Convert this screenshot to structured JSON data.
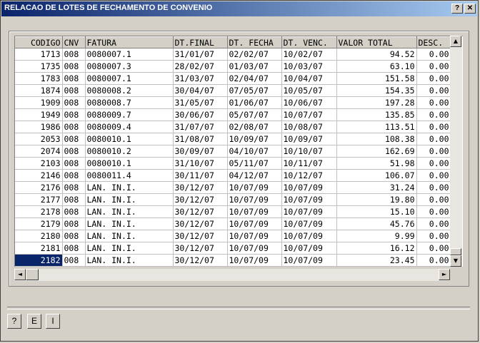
{
  "window": {
    "title": "RELACAO DE LOTES DE FECHAMENTO DE CONVENIO",
    "help_label": "?",
    "close_label": "✕"
  },
  "table": {
    "columns": [
      "CODIGO",
      "CNV",
      "FATURA",
      "DT.FINAL",
      "DT. FECHA",
      "DT. VENC.",
      "VALOR TOTAL",
      "DESC."
    ],
    "rows": [
      [
        "1713",
        "008",
        "0080007.1",
        "31/01/07",
        "02/02/07",
        "10/02/07",
        "94.52",
        "0.00"
      ],
      [
        "1735",
        "008",
        "0080007.3",
        "28/02/07",
        "01/03/07",
        "10/03/07",
        "63.10",
        "0.00"
      ],
      [
        "1783",
        "008",
        "0080007.1",
        "31/03/07",
        "02/04/07",
        "10/04/07",
        "151.58",
        "0.00"
      ],
      [
        "1874",
        "008",
        "0080008.2",
        "30/04/07",
        "07/05/07",
        "10/05/07",
        "154.35",
        "0.00"
      ],
      [
        "1909",
        "008",
        "0080008.7",
        "31/05/07",
        "01/06/07",
        "10/06/07",
        "197.28",
        "0.00"
      ],
      [
        "1949",
        "008",
        "0080009.7",
        "30/06/07",
        "05/07/07",
        "10/07/07",
        "135.85",
        "0.00"
      ],
      [
        "1986",
        "008",
        "0080009.4",
        "31/07/07",
        "02/08/07",
        "10/08/07",
        "113.51",
        "0.00"
      ],
      [
        "2053",
        "008",
        "0080010.1",
        "31/08/07",
        "10/09/07",
        "10/09/07",
        "108.38",
        "0.00"
      ],
      [
        "2074",
        "008",
        "0080010.2",
        "30/09/07",
        "04/10/07",
        "10/10/07",
        "162.69",
        "0.00"
      ],
      [
        "2103",
        "008",
        "0080010.1",
        "31/10/07",
        "05/11/07",
        "10/11/07",
        "51.98",
        "0.00"
      ],
      [
        "2146",
        "008",
        "0080011.4",
        "30/11/07",
        "04/12/07",
        "10/12/07",
        "106.07",
        "0.00"
      ],
      [
        "2176",
        "008",
        "LAN. IN.I.",
        "30/12/07",
        "10/07/09",
        "10/07/09",
        "31.24",
        "0.00"
      ],
      [
        "2177",
        "008",
        "LAN. IN.I.",
        "30/12/07",
        "10/07/09",
        "10/07/09",
        "19.80",
        "0.00"
      ],
      [
        "2178",
        "008",
        "LAN. IN.I.",
        "30/12/07",
        "10/07/09",
        "10/07/09",
        "15.10",
        "0.00"
      ],
      [
        "2179",
        "008",
        "LAN. IN.I.",
        "30/12/07",
        "10/07/09",
        "10/07/09",
        "45.76",
        "0.00"
      ],
      [
        "2180",
        "008",
        "LAN. IN.I.",
        "30/12/07",
        "10/07/09",
        "10/07/09",
        "9.99",
        "0.00"
      ],
      [
        "2181",
        "008",
        "LAN. IN.I.",
        "30/12/07",
        "10/07/09",
        "10/07/09",
        "16.12",
        "0.00"
      ],
      [
        "2182",
        "008",
        "LAN. IN.I.",
        "30/12/07",
        "10/07/09",
        "10/07/09",
        "23.45",
        "0.00"
      ]
    ],
    "selected_row": 17
  },
  "scroll": {
    "up_icon": "▲",
    "down_icon": "▼",
    "left_icon": "◄",
    "right_icon": "►"
  },
  "buttons": {
    "help": "?",
    "e": "E",
    "i": "I"
  },
  "colors": {
    "title_start": "#0a246a",
    "title_end": "#a6caf0",
    "selection": "#0a246a"
  }
}
